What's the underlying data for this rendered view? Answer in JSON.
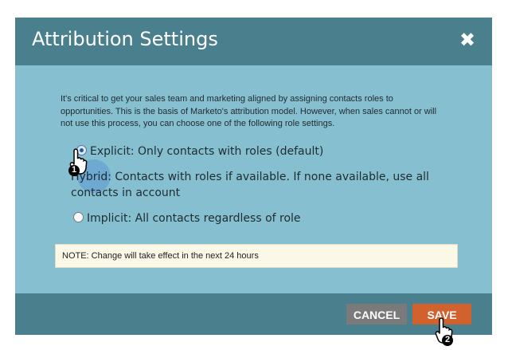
{
  "dialog": {
    "title": "Attribution Settings",
    "close_icon": "close-icon",
    "description": "It's critical to get your sales team and marketing aligned by assigning contacts roles to opportunities. This is the basis of Marketo's attribution model. However, when sales cannot or will not use this process, you can choose one of the following role settings.",
    "options": [
      {
        "label": "Explicit: Only contacts with roles (default)",
        "selected": true
      },
      {
        "label": "Hybrid: Contacts with roles if available. If none available, use all contacts in account",
        "selected": false
      },
      {
        "label": "Implicit: All contacts regardless of role",
        "selected": false
      }
    ],
    "note": "NOTE: Change will take effect in the next 24 hours",
    "buttons": {
      "cancel": "CANCEL",
      "save": "SAVE"
    }
  },
  "annotations": {
    "step1": "1",
    "step2": "2"
  },
  "colors": {
    "header_bg": "#4a7f8d",
    "body_bg": "#86c0d0",
    "save_bg": "#d2622d",
    "cancel_bg": "#7a7a7a",
    "note_bg": "#fcf8e8"
  }
}
